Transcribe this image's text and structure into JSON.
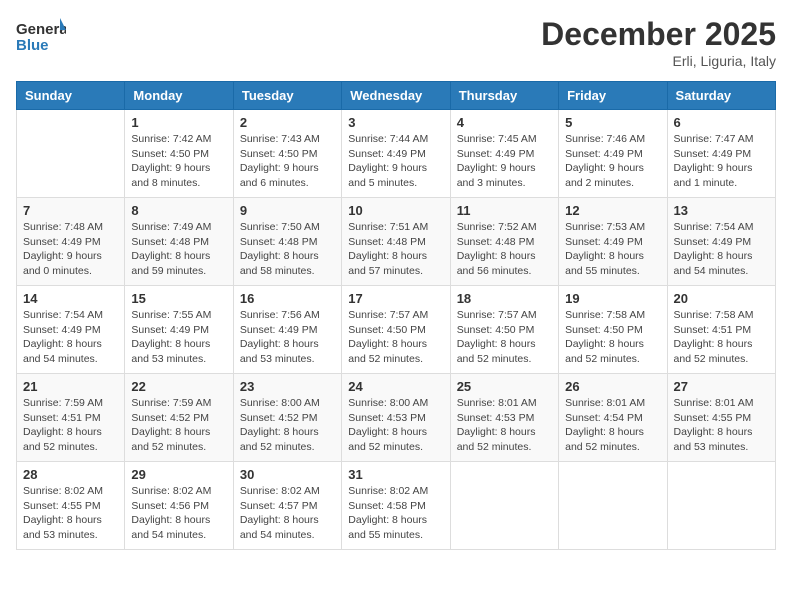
{
  "header": {
    "logo_general": "General",
    "logo_blue": "Blue",
    "month": "December 2025",
    "location": "Erli, Liguria, Italy"
  },
  "weekdays": [
    "Sunday",
    "Monday",
    "Tuesday",
    "Wednesday",
    "Thursday",
    "Friday",
    "Saturday"
  ],
  "weeks": [
    [
      {
        "day": "",
        "info": ""
      },
      {
        "day": "1",
        "info": "Sunrise: 7:42 AM\nSunset: 4:50 PM\nDaylight: 9 hours\nand 8 minutes."
      },
      {
        "day": "2",
        "info": "Sunrise: 7:43 AM\nSunset: 4:50 PM\nDaylight: 9 hours\nand 6 minutes."
      },
      {
        "day": "3",
        "info": "Sunrise: 7:44 AM\nSunset: 4:49 PM\nDaylight: 9 hours\nand 5 minutes."
      },
      {
        "day": "4",
        "info": "Sunrise: 7:45 AM\nSunset: 4:49 PM\nDaylight: 9 hours\nand 3 minutes."
      },
      {
        "day": "5",
        "info": "Sunrise: 7:46 AM\nSunset: 4:49 PM\nDaylight: 9 hours\nand 2 minutes."
      },
      {
        "day": "6",
        "info": "Sunrise: 7:47 AM\nSunset: 4:49 PM\nDaylight: 9 hours\nand 1 minute."
      }
    ],
    [
      {
        "day": "7",
        "info": "Sunrise: 7:48 AM\nSunset: 4:49 PM\nDaylight: 9 hours\nand 0 minutes."
      },
      {
        "day": "8",
        "info": "Sunrise: 7:49 AM\nSunset: 4:48 PM\nDaylight: 8 hours\nand 59 minutes."
      },
      {
        "day": "9",
        "info": "Sunrise: 7:50 AM\nSunset: 4:48 PM\nDaylight: 8 hours\nand 58 minutes."
      },
      {
        "day": "10",
        "info": "Sunrise: 7:51 AM\nSunset: 4:48 PM\nDaylight: 8 hours\nand 57 minutes."
      },
      {
        "day": "11",
        "info": "Sunrise: 7:52 AM\nSunset: 4:48 PM\nDaylight: 8 hours\nand 56 minutes."
      },
      {
        "day": "12",
        "info": "Sunrise: 7:53 AM\nSunset: 4:49 PM\nDaylight: 8 hours\nand 55 minutes."
      },
      {
        "day": "13",
        "info": "Sunrise: 7:54 AM\nSunset: 4:49 PM\nDaylight: 8 hours\nand 54 minutes."
      }
    ],
    [
      {
        "day": "14",
        "info": "Sunrise: 7:54 AM\nSunset: 4:49 PM\nDaylight: 8 hours\nand 54 minutes."
      },
      {
        "day": "15",
        "info": "Sunrise: 7:55 AM\nSunset: 4:49 PM\nDaylight: 8 hours\nand 53 minutes."
      },
      {
        "day": "16",
        "info": "Sunrise: 7:56 AM\nSunset: 4:49 PM\nDaylight: 8 hours\nand 53 minutes."
      },
      {
        "day": "17",
        "info": "Sunrise: 7:57 AM\nSunset: 4:50 PM\nDaylight: 8 hours\nand 52 minutes."
      },
      {
        "day": "18",
        "info": "Sunrise: 7:57 AM\nSunset: 4:50 PM\nDaylight: 8 hours\nand 52 minutes."
      },
      {
        "day": "19",
        "info": "Sunrise: 7:58 AM\nSunset: 4:50 PM\nDaylight: 8 hours\nand 52 minutes."
      },
      {
        "day": "20",
        "info": "Sunrise: 7:58 AM\nSunset: 4:51 PM\nDaylight: 8 hours\nand 52 minutes."
      }
    ],
    [
      {
        "day": "21",
        "info": "Sunrise: 7:59 AM\nSunset: 4:51 PM\nDaylight: 8 hours\nand 52 minutes."
      },
      {
        "day": "22",
        "info": "Sunrise: 7:59 AM\nSunset: 4:52 PM\nDaylight: 8 hours\nand 52 minutes."
      },
      {
        "day": "23",
        "info": "Sunrise: 8:00 AM\nSunset: 4:52 PM\nDaylight: 8 hours\nand 52 minutes."
      },
      {
        "day": "24",
        "info": "Sunrise: 8:00 AM\nSunset: 4:53 PM\nDaylight: 8 hours\nand 52 minutes."
      },
      {
        "day": "25",
        "info": "Sunrise: 8:01 AM\nSunset: 4:53 PM\nDaylight: 8 hours\nand 52 minutes."
      },
      {
        "day": "26",
        "info": "Sunrise: 8:01 AM\nSunset: 4:54 PM\nDaylight: 8 hours\nand 52 minutes."
      },
      {
        "day": "27",
        "info": "Sunrise: 8:01 AM\nSunset: 4:55 PM\nDaylight: 8 hours\nand 53 minutes."
      }
    ],
    [
      {
        "day": "28",
        "info": "Sunrise: 8:02 AM\nSunset: 4:55 PM\nDaylight: 8 hours\nand 53 minutes."
      },
      {
        "day": "29",
        "info": "Sunrise: 8:02 AM\nSunset: 4:56 PM\nDaylight: 8 hours\nand 54 minutes."
      },
      {
        "day": "30",
        "info": "Sunrise: 8:02 AM\nSunset: 4:57 PM\nDaylight: 8 hours\nand 54 minutes."
      },
      {
        "day": "31",
        "info": "Sunrise: 8:02 AM\nSunset: 4:58 PM\nDaylight: 8 hours\nand 55 minutes."
      },
      {
        "day": "",
        "info": ""
      },
      {
        "day": "",
        "info": ""
      },
      {
        "day": "",
        "info": ""
      }
    ]
  ]
}
